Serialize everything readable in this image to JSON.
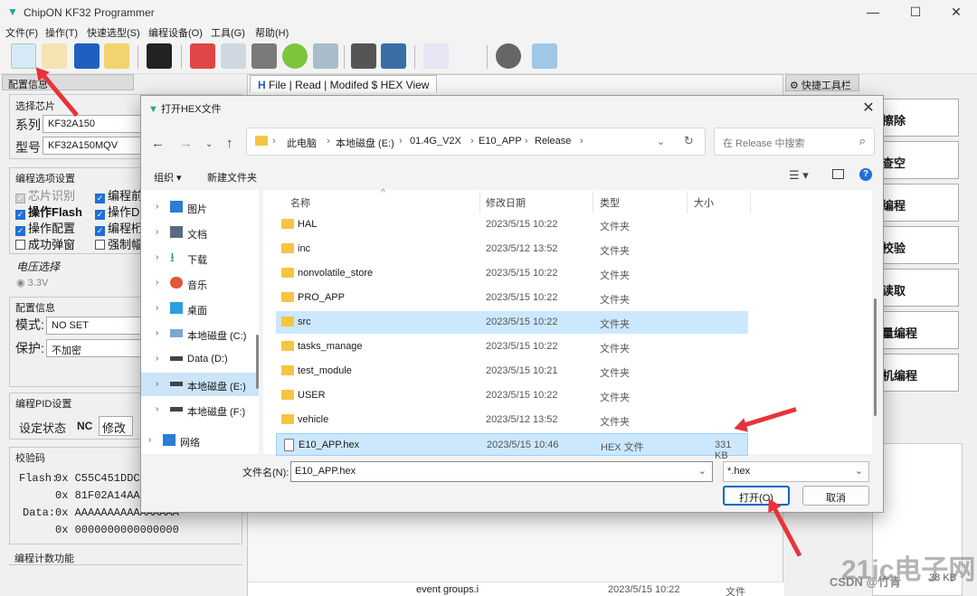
{
  "app": {
    "title": "ChipON KF32 Programmer",
    "menu": [
      "文件(F)",
      "操作(T)",
      "快速选型(S)",
      "编程设备(O)",
      "工具(G)",
      "帮助(H)"
    ]
  },
  "left_panel": {
    "tab": "配置信息",
    "select_chip": {
      "title": "选择芯片",
      "series_label": "系列",
      "series_value": "KF32A150",
      "model_label": "型号",
      "model_value": "KF32A150MQV"
    },
    "prog_options": {
      "title": "编程选项设置",
      "chip_detect": "芯片识别",
      "op_flash": "操作Flash",
      "op_config": "操作配置",
      "success_popup": "成功弹窗",
      "col2": [
        "编程前",
        "操作D",
        "编程桁",
        "强制幅"
      ]
    },
    "voltage": {
      "title": "电压选择",
      "option": "3.3V"
    },
    "config_info": {
      "title": "配置信息",
      "mode_label": "模式:",
      "mode_value": "NO SET",
      "protect_label": "保护:",
      "protect_value": "不加密"
    },
    "pid": {
      "title": "编程PID设置",
      "status_label": "设定状态",
      "status_value": "NC",
      "modify_label": "修改"
    },
    "checksum": {
      "title": "校验码",
      "flash_label": "Flash:",
      "flash_1": "0x C55C451DDC",
      "flash_2": "0x 81F02A14AA4",
      "data_label": "Data:",
      "data_1": "0x AAAAAAAAAAAAAAAA",
      "data_2": "0x 0000000000000000"
    },
    "count_title": "编程计数功能"
  },
  "hex_view": {
    "tab": "File | Read | Modifed $ HEX View",
    "bottom_file": "event groups.i",
    "bottom_date": "2023/5/15 10:22",
    "bottom_type": "文件",
    "bottom_size": "38 KB"
  },
  "quick_panel": {
    "tab": "快捷工具栏",
    "buttons": [
      "擦除",
      "查空",
      "编程",
      "校验",
      "读取",
      "量编程",
      "机编程"
    ]
  },
  "dialog": {
    "title": "打开HEX文件",
    "breadcrumb": [
      "此电脑",
      "本地磁盘 (E:)",
      "01.4G_V2X",
      "E10_APP",
      "Release"
    ],
    "search_placeholder": "在 Release 中搜索",
    "organize": "组织 ▾",
    "new_folder": "新建文件夹",
    "nav": [
      {
        "label": "图片"
      },
      {
        "label": "文档"
      },
      {
        "label": "下载"
      },
      {
        "label": "音乐"
      },
      {
        "label": "桌面"
      },
      {
        "label": "本地磁盘 (C:)"
      },
      {
        "label": "Data (D:)"
      },
      {
        "label": "本地磁盘 (E:)"
      },
      {
        "label": "本地磁盘 (F:)"
      },
      {
        "label": "网络"
      }
    ],
    "columns": {
      "name": "名称",
      "date": "修改日期",
      "type": "类型",
      "size": "大小"
    },
    "files": [
      {
        "name": "HAL",
        "date": "2023/5/15 10:22",
        "type": "文件夹",
        "size": ""
      },
      {
        "name": "inc",
        "date": "2023/5/12 13:52",
        "type": "文件夹",
        "size": ""
      },
      {
        "name": "nonvolatile_store",
        "date": "2023/5/15 10:22",
        "type": "文件夹",
        "size": ""
      },
      {
        "name": "PRO_APP",
        "date": "2023/5/15 10:22",
        "type": "文件夹",
        "size": ""
      },
      {
        "name": "src",
        "date": "2023/5/15 10:22",
        "type": "文件夹",
        "size": ""
      },
      {
        "name": "tasks_manage",
        "date": "2023/5/15 10:22",
        "type": "文件夹",
        "size": ""
      },
      {
        "name": "test_module",
        "date": "2023/5/15 10:21",
        "type": "文件夹",
        "size": ""
      },
      {
        "name": "USER",
        "date": "2023/5/15 10:22",
        "type": "文件夹",
        "size": ""
      },
      {
        "name": "vehicle",
        "date": "2023/5/12 13:52",
        "type": "文件夹",
        "size": ""
      },
      {
        "name": "E10_APP.hex",
        "date": "2023/5/15 10:46",
        "type": "HEX 文件",
        "size": "331 KB"
      }
    ],
    "filename_label": "文件名(N):",
    "filename_value": "E10_APP.hex",
    "filter_value": "*.hex",
    "open_label": "打开(O)",
    "cancel_label": "取消"
  },
  "watermark": {
    "brand": "21ic电子网",
    "credit": "CSDN @竹青"
  },
  "colors": {
    "accent": "#0067c0",
    "selection": "#cce8ff",
    "annotation": "#e8333a",
    "folder": "#f4c542"
  }
}
